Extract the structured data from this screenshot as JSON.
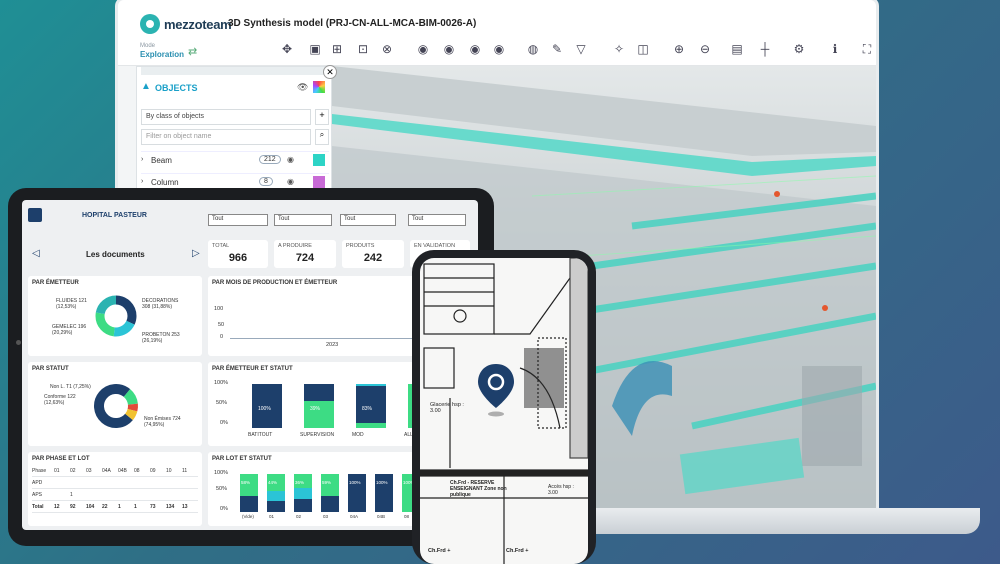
{
  "app": {
    "logo": "mezzoteam",
    "mode_label": "Mode",
    "mode_value": "Exploration",
    "model_title": "3D Synthesis model (PRJ-CN-ALL-MCA-BIM-0026-A)"
  },
  "toolbar": {
    "icons": [
      "move-icon",
      "section-icon",
      "measure-icon",
      "select-icon",
      "clear-icon",
      "eye-icon",
      "eye-icon",
      "eye-icon",
      "eye-icon",
      "globe-icon",
      "paint-icon",
      "filter-icon",
      "explode-icon",
      "cube-icon",
      "zoom-in-icon",
      "zoom-out-icon",
      "layers-icon",
      "axes-icon",
      "settings-icon",
      "info-icon",
      "fullscreen-icon"
    ]
  },
  "objects_panel": {
    "title": "OBJECTS",
    "class_select": "By class of objects",
    "filter_placeholder": "Filter on object name",
    "rows": [
      {
        "name": "Beam",
        "count": "212",
        "color": "#2dd4c6"
      },
      {
        "name": "Column",
        "count": "8",
        "color": "#c86ad6"
      }
    ]
  },
  "dashboard": {
    "hospital": "HOPITAL PASTEUR",
    "documents_title": "Les documents",
    "filters": [
      "Tout",
      "Tout",
      "Tout",
      "Tout"
    ],
    "kpis": [
      {
        "label": "TOTAL",
        "value": "966"
      },
      {
        "label": "A PRODUIRE",
        "value": "724"
      },
      {
        "label": "PRODUITS",
        "value": "242"
      },
      {
        "label": "EN VALIDATION",
        "value": ""
      }
    ],
    "par_emetteur": {
      "title": "PAR ÉMETTEUR",
      "labels": [
        "FLUIDES 121 (12,53%)",
        "GEMELEC 196 (20,29%)",
        "DECORATIONS 308 (31,88%)",
        "PROBETON 253 (26,19%)"
      ]
    },
    "par_mois": {
      "title": "PAR MOIS DE PRODUCTION ET ÉMETTEUR",
      "yticks": [
        "100",
        "50",
        "0"
      ],
      "xlabel": "2023"
    },
    "par_statut": {
      "title": "PAR STATUT",
      "labels": [
        "Non L. T1 (7,25%)",
        "Conforme 122 (12,63%)",
        "Non Émises 724 (74,95%)"
      ]
    },
    "par_emetteur_statut": {
      "title": "PAR ÉMETTEUR ET STATUT",
      "yticks": [
        "100%",
        "50%",
        "0%"
      ],
      "categories": [
        "BATITOUT",
        "SUPERVISION",
        "MOD",
        "ALLCOLORS"
      ],
      "bar_labels": [
        "100%",
        "39%",
        "83%",
        "100%"
      ]
    },
    "par_phase": {
      "title": "PAR PHASE ET LOT",
      "header": [
        "Phase",
        "01",
        "02",
        "03",
        "04A",
        "04B",
        "08",
        "09",
        "10",
        "11"
      ],
      "rows": [
        [
          "APD",
          "",
          "",
          "",
          "",
          "",
          "",
          "",
          "",
          ""
        ],
        [
          "APS",
          "",
          "1",
          "",
          "",
          "",
          "",
          "",
          "",
          ""
        ],
        [
          "Total",
          "12",
          "92",
          "104",
          "22",
          "1",
          "1",
          "73",
          "134",
          "13"
        ]
      ]
    },
    "par_lot": {
      "title": "PAR LOT ET STATUT",
      "yticks": [
        "100%",
        "50%",
        "0%"
      ],
      "categories": [
        "(Vide)",
        "01",
        "02",
        "03",
        "04A",
        "04B",
        "08",
        "09"
      ],
      "bar_labels": [
        "58%",
        "44%",
        "36%",
        "59%",
        "100%",
        "100%",
        "100%",
        "100%"
      ]
    }
  },
  "phone": {
    "rooms": [
      "Glacerie hsp : 3.00",
      "Accès hsp : 3.00",
      "Ch.Frd - RESERVE ENSEIGNANT Zone non publique",
      "Ch.Frd +",
      "Ch.Frd +"
    ]
  },
  "colors": {
    "teal": "#2bb3b1",
    "navy": "#1d3f6b",
    "green": "#3ddc84",
    "blue": "#1e90c8"
  }
}
